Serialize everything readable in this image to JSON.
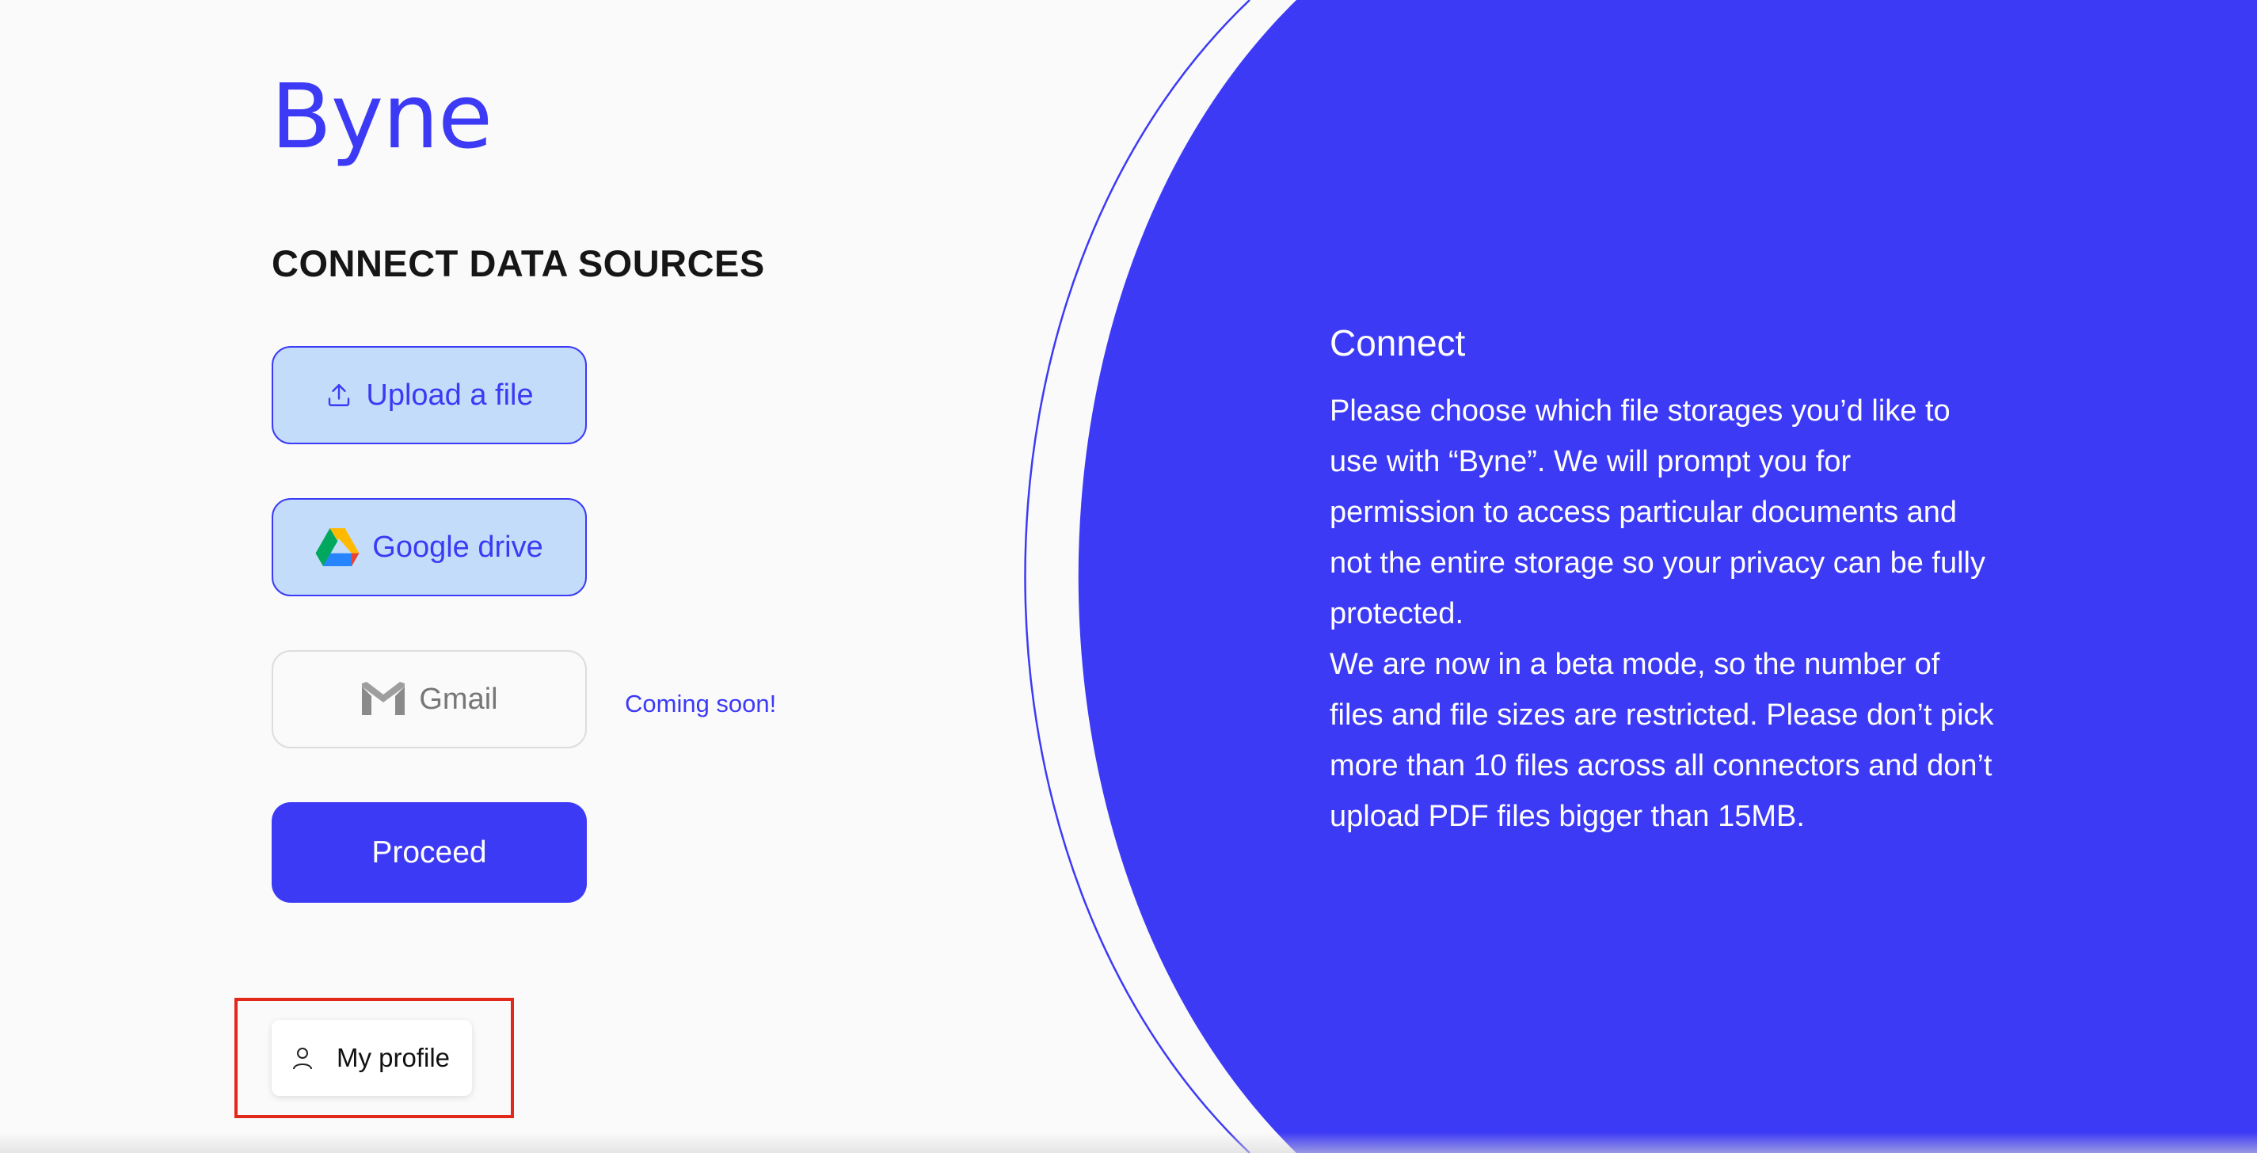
{
  "brand": {
    "logo_text": "Byne"
  },
  "colors": {
    "accent": "#3d3af5",
    "button_active_bg": "#c3dcfa",
    "panel_bg": "#3d3af5",
    "highlight": "#e2271b"
  },
  "connect": {
    "heading": "CONNECT DATA SOURCES",
    "upload": {
      "label": "Upload a file",
      "icon": "upload-icon"
    },
    "google_drive": {
      "label": "Google drive",
      "icon": "google-drive-icon"
    },
    "gmail": {
      "label": "Gmail",
      "icon": "gmail-icon",
      "status": "Coming soon!"
    },
    "proceed_label": "Proceed"
  },
  "profile": {
    "label": "My profile",
    "icon": "user-icon"
  },
  "panel": {
    "title": "Connect",
    "paragraphs": [
      "Please choose which file storages you’d like to use with “Byne”. We will prompt you for permission to access particular documents and not the entire storage so your privacy can be fully protected.",
      "We are now in a beta mode, so the number of files and file sizes are restricted. Please don’t pick more than 10 files across all connectors and don’t upload PDF files bigger than 15MB."
    ]
  }
}
